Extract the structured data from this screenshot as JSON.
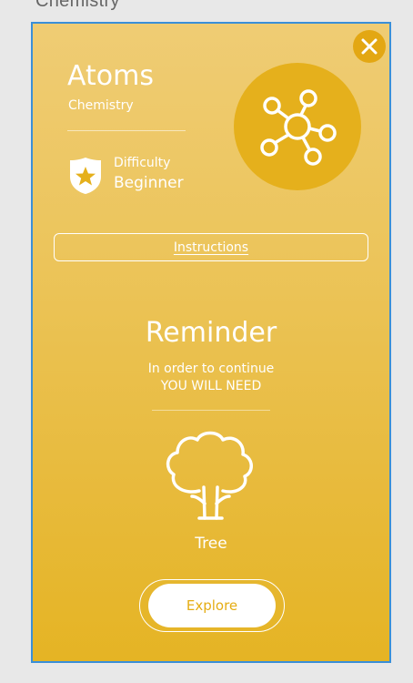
{
  "background": {
    "section_label": "Chemistry"
  },
  "card": {
    "close_icon": "close-icon",
    "title": "Atoms",
    "subtitle": "Chemistry",
    "difficulty_label": "Difficulty",
    "difficulty_value": "Beginner",
    "badge_icon": "shield-star-icon",
    "topic_icon": "atom-molecule-icon",
    "instructions_label": "Instructions",
    "reminder": {
      "title": "Reminder",
      "line1": "In order to continue",
      "line2": "YOU WILL NEED"
    },
    "requirement": {
      "icon": "tree-icon",
      "label": "Tree"
    },
    "explore_label": "Explore"
  },
  "colors": {
    "card_gradient_top": "#efcc74",
    "card_gradient_bottom": "#e5b424",
    "accent": "#e3a713",
    "card_border": "#3a8fd8",
    "text": "#ffffff"
  }
}
